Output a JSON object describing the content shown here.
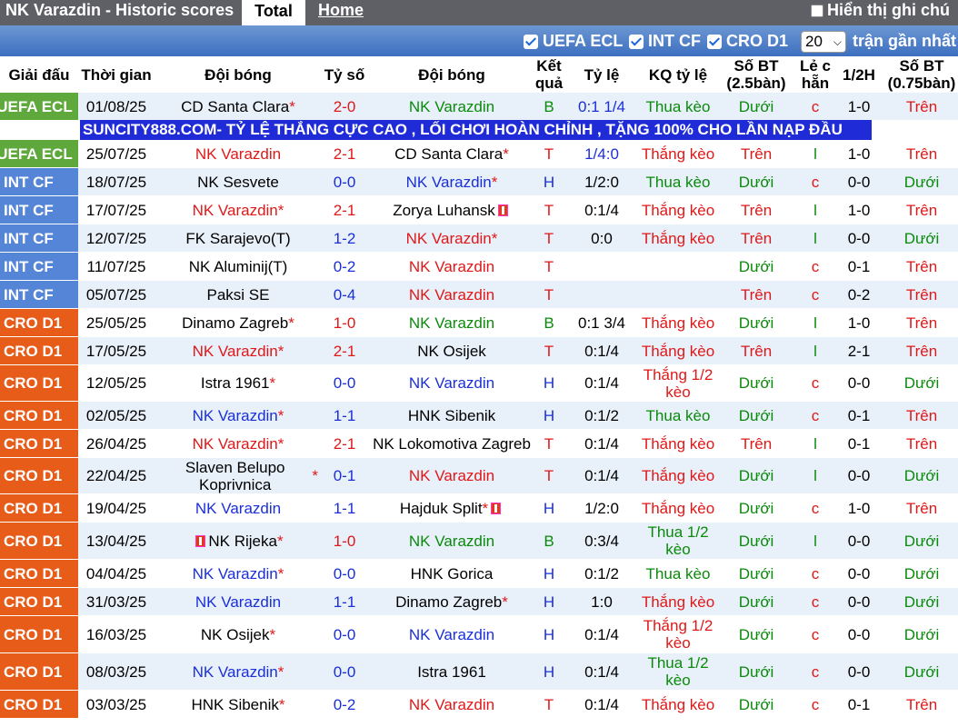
{
  "topbar": {
    "title": "NK Varazdin - Historic scores",
    "tab_total": "Total",
    "tab_home": "Home",
    "show_odds": "Hiển thị ghi chú"
  },
  "filters": {
    "items": [
      "UEFA ECL",
      "INT CF",
      "CRO D1"
    ],
    "count_value": "20",
    "recent_label": "trận gần nhất"
  },
  "headers": {
    "league": "Giải đấu",
    "time": "Thời gian",
    "home": "Đội bóng",
    "score": "Tỷ số",
    "away": "Đội bóng",
    "result": "Kết quả",
    "odds": "Tỷ lệ",
    "odds_result": "KQ tỷ lệ",
    "ou_25": "Số BT (2.5bàn)",
    "odd_even": "Lẻ c hẵn",
    "half": "1/2H",
    "ou_075": "Số BT (0.75bàn)"
  },
  "ad_text": "SUNCITY888.COM- TỶ LỆ THẮNG CỰC CAO , LỐI CHƠI HOÀN CHỈNH , TẶNG 100% CHO LẦN NẠP ĐẦU",
  "colors": {
    "ecl": "#5ea83c",
    "int": "#5585d6",
    "cro": "#e85c1a",
    "row_alt": "#e8f0fa"
  },
  "rows": [
    {
      "league": "UEFA ECL",
      "date": "01/08/25",
      "home": "CD Santa Clara",
      "home_star": "*",
      "home_c": "black",
      "score": "2-0",
      "score_c": "red",
      "away": "NK Varazdin",
      "away_star": "",
      "away_c": "green",
      "res": "B",
      "res_c": "green",
      "odds": "0:1 1/4",
      "odds_c": "blue",
      "kq": "Thua kèo",
      "kq_c": "green",
      "ou": "Dưới",
      "ou_c": "green",
      "oe": "c",
      "oe_c": "red",
      "half": "1-0",
      "h075": "Trên",
      "h075_c": "red"
    },
    {
      "league": "UEFA ECL",
      "date": "25/07/25",
      "home": "NK Varazdin",
      "home_star": "",
      "home_c": "red",
      "score": "2-1",
      "score_c": "red",
      "away": "CD Santa Clara",
      "away_star": "*",
      "away_c": "black",
      "res": "T",
      "res_c": "red",
      "odds": "1/4:0",
      "odds_c": "blue",
      "kq": "Thắng kèo",
      "kq_c": "red",
      "ou": "Trên",
      "ou_c": "red",
      "oe": "l",
      "oe_c": "green",
      "half": "1-0",
      "h075": "Trên",
      "h075_c": "red"
    },
    {
      "league": "INT CF",
      "date": "18/07/25",
      "home": "NK Sesvete",
      "home_star": "",
      "home_c": "black",
      "score": "0-0",
      "score_c": "blue",
      "away": "NK Varazdin",
      "away_star": "*",
      "away_c": "blue",
      "res": "H",
      "res_c": "blue",
      "odds": "1/2:0",
      "odds_c": "black",
      "kq": "Thua kèo",
      "kq_c": "green",
      "ou": "Dưới",
      "ou_c": "green",
      "oe": "c",
      "oe_c": "red",
      "half": "0-0",
      "h075": "Dưới",
      "h075_c": "green"
    },
    {
      "league": "INT CF",
      "date": "17/07/25",
      "home": "NK Varazdin",
      "home_star": "*",
      "home_c": "red",
      "score": "2-1",
      "score_c": "red",
      "away": "Zorya Luhansk",
      "away_star": "",
      "away_c": "black",
      "away_flag": true,
      "res": "T",
      "res_c": "red",
      "odds": "0:1/4",
      "odds_c": "black",
      "kq": "Thắng kèo",
      "kq_c": "red",
      "ou": "Trên",
      "ou_c": "red",
      "oe": "l",
      "oe_c": "green",
      "half": "1-0",
      "h075": "Trên",
      "h075_c": "red"
    },
    {
      "league": "INT CF",
      "date": "12/07/25",
      "home": "FK Sarajevo(T)",
      "home_star": "",
      "home_c": "black",
      "score": "1-2",
      "score_c": "blue",
      "away": "NK Varazdin",
      "away_star": "*",
      "away_c": "red",
      "res": "T",
      "res_c": "red",
      "odds": "0:0",
      "odds_c": "black",
      "kq": "Thắng kèo",
      "kq_c": "red",
      "ou": "Trên",
      "ou_c": "red",
      "oe": "l",
      "oe_c": "green",
      "half": "0-0",
      "h075": "Dưới",
      "h075_c": "green"
    },
    {
      "league": "INT CF",
      "date": "11/07/25",
      "home": "NK Aluminij(T)",
      "home_star": "",
      "home_c": "black",
      "score": "0-2",
      "score_c": "blue",
      "away": "NK Varazdin",
      "away_star": "",
      "away_c": "red",
      "res": "T",
      "res_c": "red",
      "odds": "",
      "odds_c": "black",
      "kq": "",
      "kq_c": "red",
      "ou": "Dưới",
      "ou_c": "green",
      "oe": "c",
      "oe_c": "red",
      "half": "0-1",
      "h075": "Trên",
      "h075_c": "red"
    },
    {
      "league": "INT CF",
      "date": "05/07/25",
      "home": "Paksi SE",
      "home_star": "",
      "home_c": "black",
      "score": "0-4",
      "score_c": "blue",
      "away": "NK Varazdin",
      "away_star": "",
      "away_c": "red",
      "res": "T",
      "res_c": "red",
      "odds": "",
      "odds_c": "black",
      "kq": "",
      "kq_c": "red",
      "ou": "Trên",
      "ou_c": "red",
      "oe": "c",
      "oe_c": "red",
      "half": "0-2",
      "h075": "Trên",
      "h075_c": "red"
    },
    {
      "league": "CRO D1",
      "date": "25/05/25",
      "home": "Dinamo Zagreb",
      "home_star": "*",
      "home_c": "black",
      "score": "1-0",
      "score_c": "red",
      "away": "NK Varazdin",
      "away_star": "",
      "away_c": "green",
      "res": "B",
      "res_c": "green",
      "odds": "0:1 3/4",
      "odds_c": "black",
      "kq": "Thắng kèo",
      "kq_c": "red",
      "ou": "Dưới",
      "ou_c": "green",
      "oe": "l",
      "oe_c": "green",
      "half": "1-0",
      "h075": "Trên",
      "h075_c": "red"
    },
    {
      "league": "CRO D1",
      "date": "17/05/25",
      "home": "NK Varazdin",
      "home_star": "*",
      "home_c": "red",
      "score": "2-1",
      "score_c": "red",
      "away": "NK Osijek",
      "away_star": "",
      "away_c": "black",
      "res": "T",
      "res_c": "red",
      "odds": "0:1/4",
      "odds_c": "black",
      "kq": "Thắng kèo",
      "kq_c": "red",
      "ou": "Trên",
      "ou_c": "red",
      "oe": "l",
      "oe_c": "green",
      "half": "2-1",
      "h075": "Trên",
      "h075_c": "red"
    },
    {
      "league": "CRO D1",
      "date": "12/05/25",
      "home": "Istra 1961",
      "home_star": "*",
      "home_c": "black",
      "score": "0-0",
      "score_c": "blue",
      "away": "NK Varazdin",
      "away_star": "",
      "away_c": "blue",
      "res": "H",
      "res_c": "blue",
      "odds": "0:1/4",
      "odds_c": "black",
      "kq": "Thắng 1/2 kèo",
      "kq_c": "red",
      "kq_two": true,
      "ou": "Dưới",
      "ou_c": "green",
      "oe": "c",
      "oe_c": "red",
      "half": "0-0",
      "h075": "Dưới",
      "h075_c": "green"
    },
    {
      "league": "CRO D1",
      "date": "02/05/25",
      "home": "NK Varazdin",
      "home_star": "*",
      "home_c": "blue",
      "score": "1-1",
      "score_c": "blue",
      "away": "HNK Sibenik",
      "away_star": "",
      "away_c": "black",
      "res": "H",
      "res_c": "blue",
      "odds": "0:1/2",
      "odds_c": "black",
      "kq": "Thua kèo",
      "kq_c": "green",
      "ou": "Dưới",
      "ou_c": "green",
      "oe": "c",
      "oe_c": "red",
      "half": "0-1",
      "h075": "Trên",
      "h075_c": "red"
    },
    {
      "league": "CRO D1",
      "date": "26/04/25",
      "home": "NK Varazdin",
      "home_star": "*",
      "home_c": "red",
      "score": "2-1",
      "score_c": "red",
      "away": "NK Lokomotiva Zagreb",
      "away_star": "",
      "away_c": "black",
      "res": "T",
      "res_c": "red",
      "odds": "0:1/4",
      "odds_c": "black",
      "kq": "Thắng kèo",
      "kq_c": "red",
      "ou": "Trên",
      "ou_c": "red",
      "oe": "l",
      "oe_c": "green",
      "half": "0-1",
      "h075": "Trên",
      "h075_c": "red"
    },
    {
      "league": "CRO D1",
      "date": "22/04/25",
      "home": "Slaven Belupo Koprivnica",
      "home_star": "*",
      "home_c": "black",
      "home_two": true,
      "score": "0-1",
      "score_c": "blue",
      "away": "NK Varazdin",
      "away_star": "",
      "away_c": "red",
      "res": "T",
      "res_c": "red",
      "odds": "0:1/4",
      "odds_c": "black",
      "kq": "Thắng kèo",
      "kq_c": "red",
      "ou": "Dưới",
      "ou_c": "green",
      "oe": "l",
      "oe_c": "green",
      "half": "0-0",
      "h075": "Dưới",
      "h075_c": "green"
    },
    {
      "league": "CRO D1",
      "date": "19/04/25",
      "home": "NK Varazdin",
      "home_star": "",
      "home_c": "blue",
      "score": "1-1",
      "score_c": "blue",
      "away": "Hajduk Split",
      "away_star": "*",
      "away_c": "black",
      "away_flag": true,
      "res": "H",
      "res_c": "blue",
      "odds": "1/2:0",
      "odds_c": "black",
      "kq": "Thắng kèo",
      "kq_c": "red",
      "ou": "Dưới",
      "ou_c": "green",
      "oe": "c",
      "oe_c": "red",
      "half": "1-0",
      "h075": "Trên",
      "h075_c": "red"
    },
    {
      "league": "CRO D1",
      "date": "13/04/25",
      "home": "NK Rijeka",
      "home_star": "*",
      "home_c": "black",
      "home_flag": true,
      "score": "1-0",
      "score_c": "red",
      "away": "NK Varazdin",
      "away_star": "",
      "away_c": "green",
      "res": "B",
      "res_c": "green",
      "odds": "0:3/4",
      "odds_c": "black",
      "kq": "Thua 1/2 kèo",
      "kq_c": "green",
      "kq_two": true,
      "ou": "Dưới",
      "ou_c": "green",
      "oe": "l",
      "oe_c": "green",
      "half": "0-0",
      "h075": "Dưới",
      "h075_c": "green"
    },
    {
      "league": "CRO D1",
      "date": "04/04/25",
      "home": "NK Varazdin",
      "home_star": "*",
      "home_c": "blue",
      "score": "0-0",
      "score_c": "blue",
      "away": "HNK Gorica",
      "away_star": "",
      "away_c": "black",
      "res": "H",
      "res_c": "blue",
      "odds": "0:1/2",
      "odds_c": "black",
      "kq": "Thua kèo",
      "kq_c": "green",
      "ou": "Dưới",
      "ou_c": "green",
      "oe": "c",
      "oe_c": "red",
      "half": "0-0",
      "h075": "Dưới",
      "h075_c": "green"
    },
    {
      "league": "CRO D1",
      "date": "31/03/25",
      "home": "NK Varazdin",
      "home_star": "",
      "home_c": "blue",
      "score": "1-1",
      "score_c": "blue",
      "away": "Dinamo Zagreb",
      "away_star": "*",
      "away_c": "black",
      "res": "H",
      "res_c": "blue",
      "odds": "1:0",
      "odds_c": "black",
      "kq": "Thắng kèo",
      "kq_c": "red",
      "ou": "Dưới",
      "ou_c": "green",
      "oe": "c",
      "oe_c": "red",
      "half": "0-0",
      "h075": "Dưới",
      "h075_c": "green"
    },
    {
      "league": "CRO D1",
      "date": "16/03/25",
      "home": "NK Osijek",
      "home_star": "*",
      "home_c": "black",
      "score": "0-0",
      "score_c": "blue",
      "away": "NK Varazdin",
      "away_star": "",
      "away_c": "blue",
      "res": "H",
      "res_c": "blue",
      "odds": "0:1/4",
      "odds_c": "black",
      "kq": "Thắng 1/2 kèo",
      "kq_c": "red",
      "kq_two": true,
      "ou": "Dưới",
      "ou_c": "green",
      "oe": "c",
      "oe_c": "red",
      "half": "0-0",
      "h075": "Dưới",
      "h075_c": "green"
    },
    {
      "league": "CRO D1",
      "date": "08/03/25",
      "home": "NK Varazdin",
      "home_star": "*",
      "home_c": "blue",
      "score": "0-0",
      "score_c": "blue",
      "away": "Istra 1961",
      "away_star": "",
      "away_c": "black",
      "res": "H",
      "res_c": "blue",
      "odds": "0:1/4",
      "odds_c": "black",
      "kq": "Thua 1/2 kèo",
      "kq_c": "green",
      "kq_two": true,
      "ou": "Dưới",
      "ou_c": "green",
      "oe": "c",
      "oe_c": "red",
      "half": "0-0",
      "h075": "Dưới",
      "h075_c": "green"
    },
    {
      "league": "CRO D1",
      "date": "03/03/25",
      "home": "HNK Sibenik",
      "home_star": "*",
      "home_c": "black",
      "score": "0-2",
      "score_c": "blue",
      "away": "NK Varazdin",
      "away_star": "",
      "away_c": "red",
      "res": "T",
      "res_c": "red",
      "odds": "0:1/4",
      "odds_c": "black",
      "kq": "Thắng kèo",
      "kq_c": "red",
      "ou": "Dưới",
      "ou_c": "green",
      "oe": "c",
      "oe_c": "red",
      "half": "0-1",
      "h075": "Trên",
      "h075_c": "red"
    }
  ]
}
